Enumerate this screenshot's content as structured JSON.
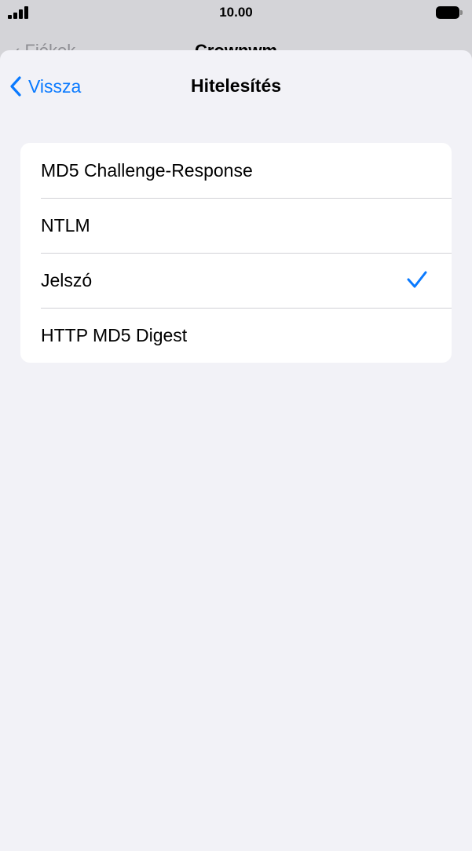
{
  "status_bar": {
    "time": "10.00"
  },
  "underlying_nav": {
    "back_label": "Fiókok",
    "title": "Crownwm"
  },
  "nav": {
    "back_label": "Vissza",
    "title": "Hitelesítés"
  },
  "options": [
    {
      "label": "MD5 Challenge-Response",
      "selected": false
    },
    {
      "label": "NTLM",
      "selected": false
    },
    {
      "label": "Jelszó",
      "selected": true
    },
    {
      "label": "HTTP MD5 Digest",
      "selected": false
    }
  ],
  "colors": {
    "accent": "#0a7aff",
    "sheet_background": "#f2f2f7",
    "status_background": "#d4d4d8"
  },
  "icons": {
    "back": "chevron-left-icon",
    "selected": "checkmark-icon"
  }
}
